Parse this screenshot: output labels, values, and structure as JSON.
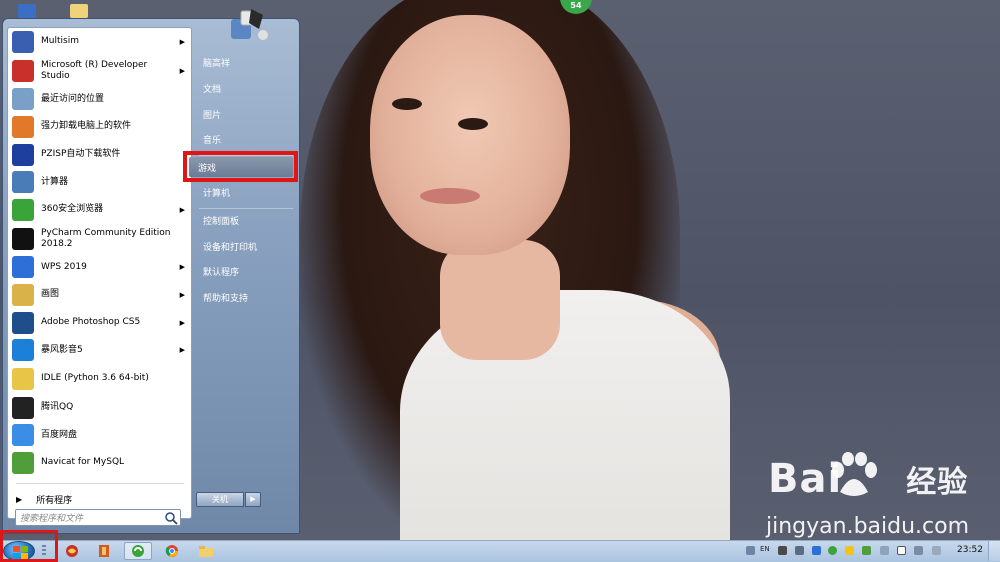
{
  "desktop": {
    "badge": "54",
    "watermark_brand": "Bai",
    "watermark_sub": "经验",
    "watermark_url": "jingyan.baidu.com"
  },
  "start_menu": {
    "programs": [
      {
        "label": "Multisim",
        "has_arrow": true,
        "icon": "multisim-icon",
        "color": "#3b5fb0"
      },
      {
        "label": "Microsoft (R) Developer Studio",
        "has_arrow": true,
        "icon": "devstudio-icon",
        "color": "#c9302c"
      },
      {
        "label": "最近访问的位置",
        "has_arrow": false,
        "icon": "recent-places-icon",
        "color": "#7ba0c8"
      },
      {
        "label": "强力卸载电脑上的软件",
        "has_arrow": false,
        "icon": "uninstaller-icon",
        "color": "#e07a2a"
      },
      {
        "label": "PZISP自动下载软件",
        "has_arrow": false,
        "icon": "pzisp-icon",
        "color": "#1e3f9e"
      },
      {
        "label": "计算器",
        "has_arrow": false,
        "icon": "calculator-icon",
        "color": "#4a7db8"
      },
      {
        "label": "360安全浏览器",
        "has_arrow": true,
        "icon": "browser-360-icon",
        "color": "#3aa33a"
      },
      {
        "label": "PyCharm Community Edition 2018.2",
        "has_arrow": false,
        "icon": "pycharm-icon",
        "color": "#111111"
      },
      {
        "label": "WPS 2019",
        "has_arrow": true,
        "icon": "wps-icon",
        "color": "#2d6fd6"
      },
      {
        "label": "画图",
        "has_arrow": true,
        "icon": "paint-icon",
        "color": "#d9b24a"
      },
      {
        "label": "Adobe Photoshop CS5",
        "has_arrow": true,
        "icon": "photoshop-icon",
        "color": "#1f4f8a"
      },
      {
        "label": "暴风影音5",
        "has_arrow": true,
        "icon": "baofeng-icon",
        "color": "#1c7fd8"
      },
      {
        "label": "IDLE (Python 3.6 64-bit)",
        "has_arrow": false,
        "icon": "idle-python-icon",
        "color": "#e8c547"
      },
      {
        "label": "腾讯QQ",
        "has_arrow": false,
        "icon": "qq-icon",
        "color": "#222222"
      },
      {
        "label": "百度网盘",
        "has_arrow": false,
        "icon": "baidu-netdisk-icon",
        "color": "#3a8ee6"
      },
      {
        "label": "Navicat for MySQL",
        "has_arrow": false,
        "icon": "navicat-icon",
        "color": "#4f9e3a"
      }
    ],
    "all_programs": "所有程序",
    "search_placeholder": "搜索程序和文件",
    "right_items": {
      "user": "脑高祥",
      "documents": "文档",
      "pictures": "图片",
      "music": "音乐",
      "games": "游戏",
      "computer": "计算机",
      "control_panel": "控制面板",
      "devices_printers": "设备和打印机",
      "default_programs": "默认程序",
      "help_support": "帮助和支持"
    },
    "shutdown_label": "关机"
  },
  "taskbar": {
    "language": "EN",
    "clock": "23:52"
  },
  "colors": {
    "highlight_red": "#e01616",
    "taskbar_blue": "#aac4e0"
  }
}
